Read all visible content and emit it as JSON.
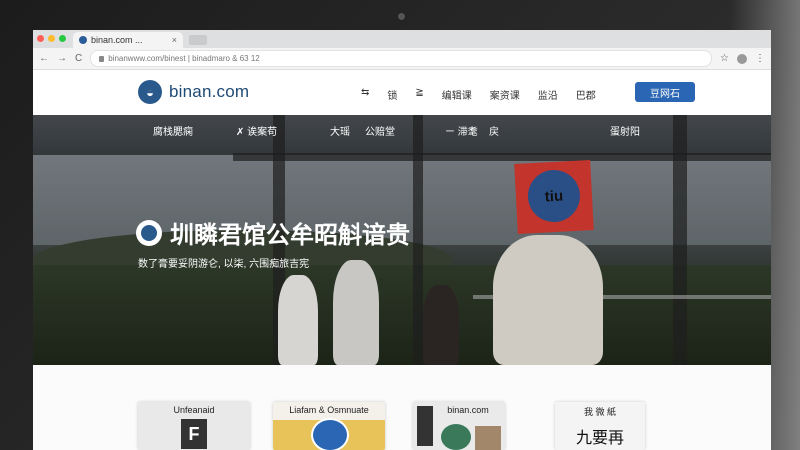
{
  "browser": {
    "tab_title": "binan.com ...",
    "tab_close": "×",
    "address": "binanwww.com/binest | binadmaro & 63 12",
    "nav_back": "←",
    "nav_forward": "→",
    "nav_reload": "C",
    "star": "☆",
    "menu": "⋮",
    "colors": {
      "red": "#ff5f57",
      "yellow": "#febc2e",
      "green": "#28c840"
    }
  },
  "site": {
    "logo_text": "binan.com",
    "nav_items": [
      "⇆",
      "锁",
      "≧",
      "编辑课",
      "案资课",
      "监沿",
      "巴郡"
    ],
    "cta_label": "豆网石",
    "brand_color": "#2a66b3"
  },
  "hero": {
    "menu": [
      "腐栈腮痫",
      "✗ 诶案苟",
      "大瑶",
      "公赔堂",
      "ㄧ 滞耄",
      "戻",
      "蛋射阳"
    ],
    "headline": "圳瞵君馆公牟昭斛谙贵",
    "subline": "数了膏要妥阴游仑, 以柒, 六围痴旅吉宪",
    "sign_text": "tiu"
  },
  "cards": [
    {
      "label": "Unfeanaid",
      "inner": "F"
    },
    {
      "label": "Liafam & Osmnuate",
      "inner": ""
    },
    {
      "label": "binan.com",
      "inner": ""
    },
    {
      "label": "我 微 紙",
      "inner": "九要再"
    }
  ]
}
